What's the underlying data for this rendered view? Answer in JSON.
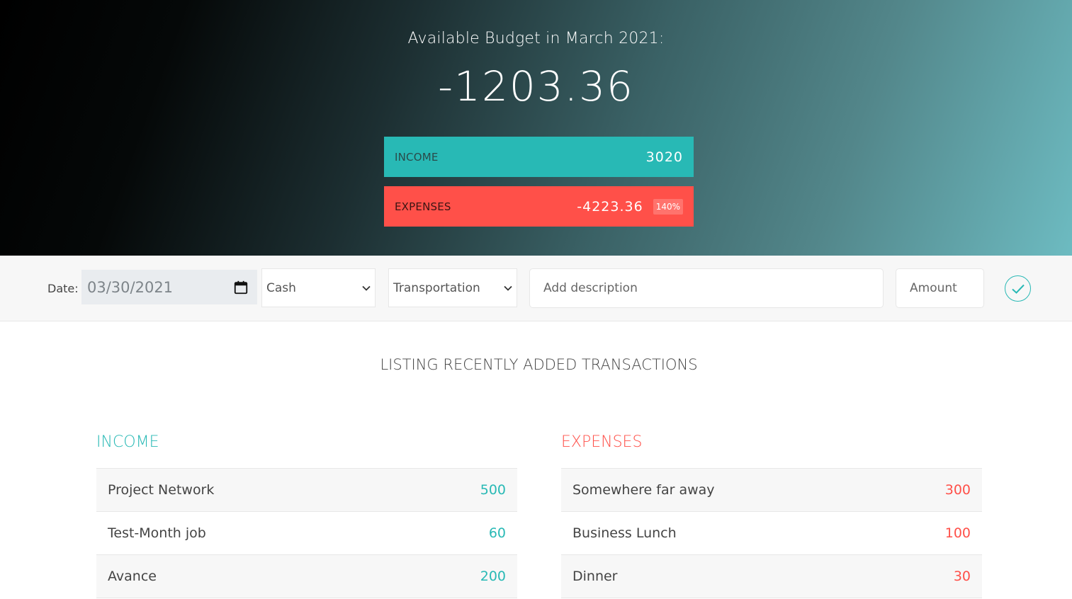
{
  "hero": {
    "title": "Available Budget in March 2021:",
    "value": "-1203.36"
  },
  "summary": {
    "income": {
      "label": "Income",
      "value": "3020"
    },
    "expenses": {
      "label": "Expenses",
      "value": "-4223.36",
      "percentage": "140%"
    }
  },
  "add_bar": {
    "date_label": "Date:",
    "date_value": "03/30/2021",
    "payment_select": "Cash",
    "category_select": "Transportation",
    "description_placeholder": "Add description",
    "amount_placeholder": "Amount"
  },
  "listing": {
    "title": "Listing recently added transactions",
    "income": {
      "title": "Income",
      "items": [
        {
          "description": "Project Network",
          "value": "500"
        },
        {
          "description": "Test-Month job",
          "value": "60"
        },
        {
          "description": "Avance",
          "value": "200"
        }
      ]
    },
    "expenses": {
      "title": "Expenses",
      "items": [
        {
          "description": "Somewhere far away",
          "value": "300"
        },
        {
          "description": "Business Lunch",
          "value": "100"
        },
        {
          "description": "Dinner",
          "value": "30"
        }
      ]
    }
  },
  "colors": {
    "income": "#28b9b5",
    "expenses": "#ff5049"
  },
  "icons": {
    "date": "calendar-icon",
    "select": "chevron-down-icon",
    "submit": "check-circle-icon"
  }
}
